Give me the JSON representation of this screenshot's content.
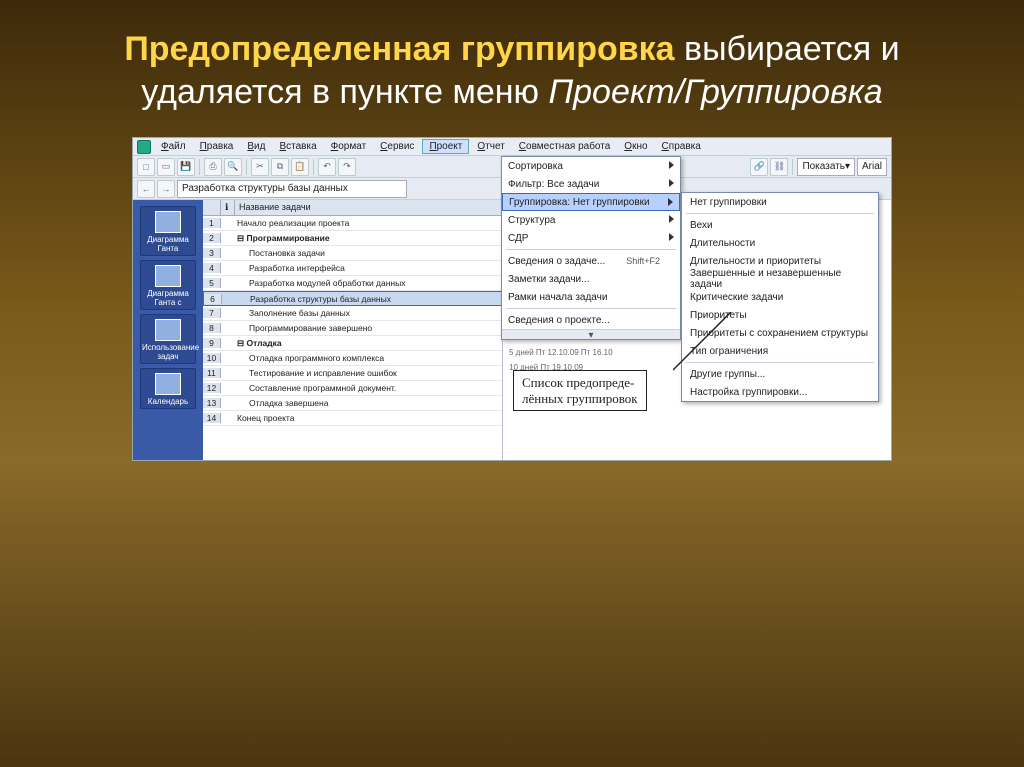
{
  "title": {
    "accent": "Предопределенная группировка",
    "plain": " выбирается и удаляется в пункте меню ",
    "italic": "Проект/Группировка"
  },
  "menubar": [
    "Файл",
    "Правка",
    "Вид",
    "Вставка",
    "Формат",
    "Сервис",
    "Проект",
    "Отчет",
    "Совместная работа",
    "Окно",
    "Справка"
  ],
  "toolbar": {
    "show_label": "Показать",
    "font": "Arial"
  },
  "breadcrumb": "Разработка структуры базы данных",
  "sheet": {
    "header_name": "Название задачи",
    "rows": [
      {
        "n": "1",
        "txt": "Начало реализации проекта",
        "b": false,
        "ind": 0
      },
      {
        "n": "2",
        "txt": "Программирование",
        "b": true,
        "ind": 0
      },
      {
        "n": "3",
        "txt": "Постановка задачи",
        "b": false,
        "ind": 1
      },
      {
        "n": "4",
        "txt": "Разработка интерфейса",
        "b": false,
        "ind": 1
      },
      {
        "n": "5",
        "txt": "Разработка модулей обработки данных",
        "b": false,
        "ind": 1
      },
      {
        "n": "6",
        "txt": "Разработка структуры базы данных",
        "b": false,
        "ind": 1,
        "sel": true
      },
      {
        "n": "7",
        "txt": "Заполнение базы данных",
        "b": false,
        "ind": 1
      },
      {
        "n": "8",
        "txt": "Программирование завершено",
        "b": false,
        "ind": 1
      },
      {
        "n": "9",
        "txt": "Отладка",
        "b": true,
        "ind": 0
      },
      {
        "n": "10",
        "txt": "Отладка программного комплекса",
        "b": false,
        "ind": 1
      },
      {
        "n": "11",
        "txt": "Тестирование и исправление ошибок",
        "b": false,
        "ind": 1
      },
      {
        "n": "12",
        "txt": "Составление программной документ.",
        "b": false,
        "ind": 1
      },
      {
        "n": "13",
        "txt": "Отладка завершена",
        "b": false,
        "ind": 1
      },
      {
        "n": "14",
        "txt": "Конец проекта",
        "b": false,
        "ind": 0
      }
    ]
  },
  "sidepane": [
    {
      "label": "Диаграмма Ганта"
    },
    {
      "label": "Диаграмма Ганта с"
    },
    {
      "label": "Использование задач"
    },
    {
      "label": "Календарь"
    }
  ],
  "project_menu": [
    {
      "label": "Сортировка",
      "arrow": true
    },
    {
      "label": "Фильтр: Все задачи",
      "arrow": true
    },
    {
      "label": "Группировка: Нет группировки",
      "arrow": true,
      "sel": true
    },
    {
      "label": "Структура",
      "arrow": true
    },
    {
      "label": "СДР",
      "arrow": true
    },
    {
      "sep": true
    },
    {
      "label": "Сведения о задаче...",
      "short": "Shift+F2"
    },
    {
      "label": "Заметки задачи..."
    },
    {
      "label": "Рамки начала задачи"
    },
    {
      "sep": true
    },
    {
      "label": "Сведения о проекте..."
    }
  ],
  "submenu": [
    {
      "label": "Нет группировки"
    },
    {
      "sep": true
    },
    {
      "label": "Вехи"
    },
    {
      "label": "Длительности"
    },
    {
      "label": "Длительности и приоритеты"
    },
    {
      "label": "Завершенные и незавершенные задачи"
    },
    {
      "label": "Критические задачи"
    },
    {
      "label": "Приоритеты"
    },
    {
      "label": "Приоритеты с сохранением структуры"
    },
    {
      "label": "Тип ограничения"
    },
    {
      "sep": true
    },
    {
      "label": "Другие группы..."
    },
    {
      "label": "Настройка группировки..."
    }
  ],
  "callout": {
    "line1": "Список предопреде-",
    "line2": "лённых группировок"
  },
  "gantt_hint": {
    "a": "5 дней   Пт 12.10.09   Пт 16.10",
    "b": "10 дней   Пт 19.10.09"
  }
}
